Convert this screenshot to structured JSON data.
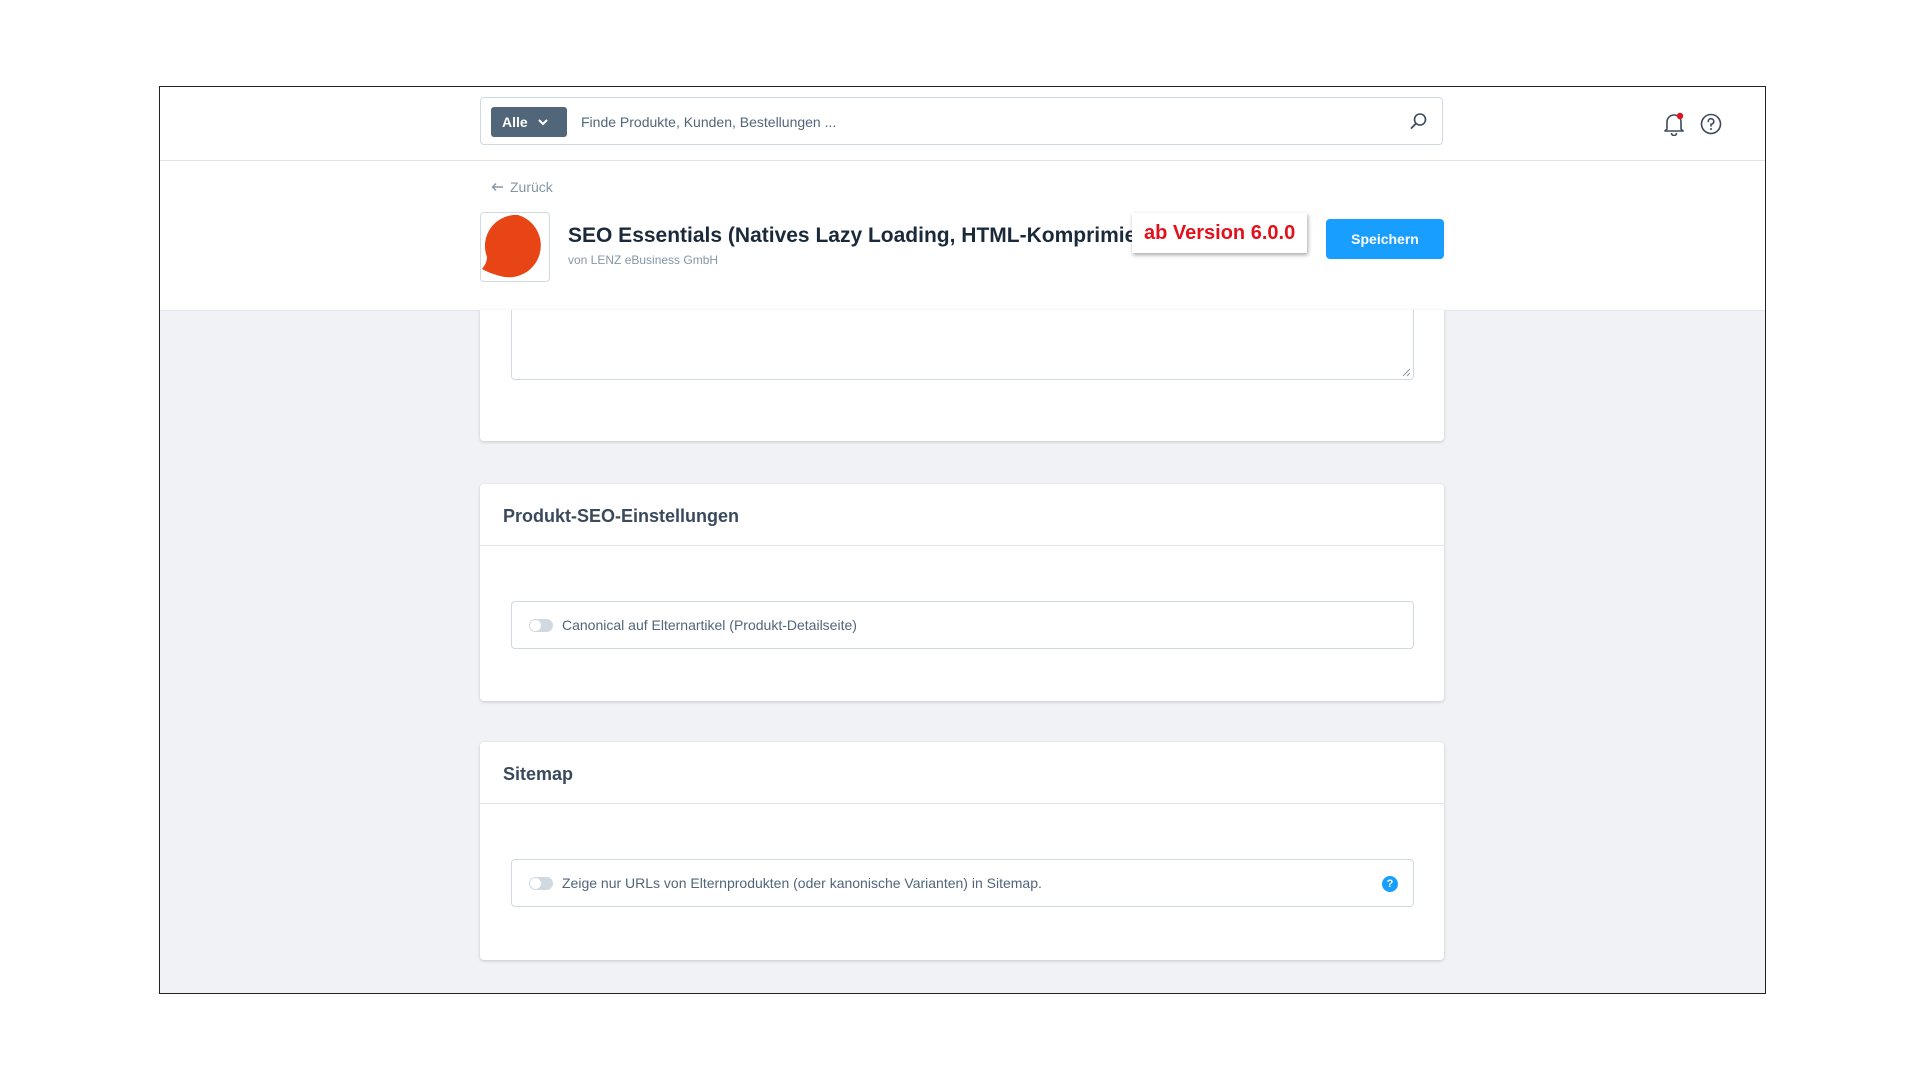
{
  "search": {
    "type_label": "Alle",
    "placeholder": "Finde Produkte, Kunden, Bestellungen ..."
  },
  "header": {
    "back_label": "Zurück",
    "plugin_title": "SEO Essentials (Natives Lazy Loading, HTML-Komprimier...",
    "plugin_author": "von LENZ eBusiness GmbH",
    "save_label": "Speichern",
    "version_badge": "ab Version 6.0.0"
  },
  "cards": {
    "product_seo": {
      "title": "Produkt-SEO-Einstellungen",
      "toggle_label": "Canonical auf Elternartikel (Produkt-Detailseite)"
    },
    "sitemap": {
      "title": "Sitemap",
      "toggle_label": "Zeige nur URLs von Elternprodukten (oder kanonische Varianten) in Sitemap.",
      "info_icon": "?"
    }
  },
  "colors": {
    "primary": "#189eff",
    "logo": "#e84516",
    "badge_text": "#e3111c",
    "notification_dot": "#e3111c"
  }
}
